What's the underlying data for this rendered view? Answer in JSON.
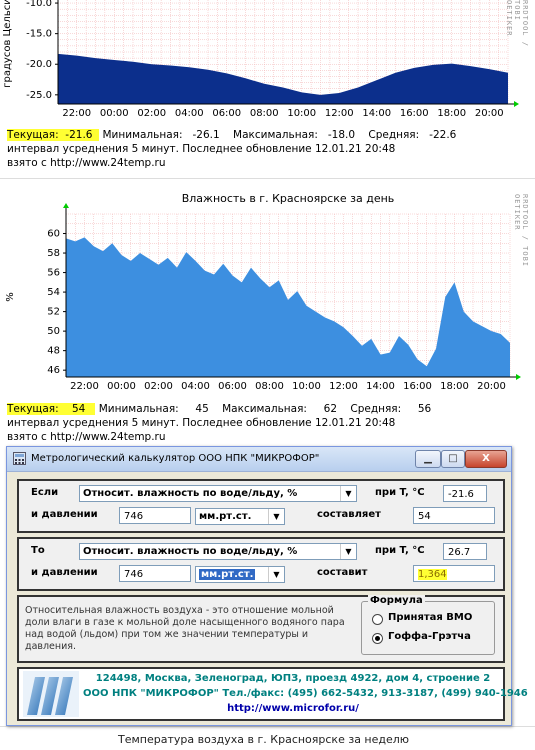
{
  "chart_top": {
    "chart_data": {
      "type": "area",
      "title": "",
      "ylabel": "градусов Цельсия",
      "ylim": [
        -26.5,
        -9.5
      ],
      "yticks": [
        "-10.0",
        "-15.0",
        "-20.0",
        "-25.0"
      ],
      "xticks": [
        "22:00",
        "00:00",
        "02:00",
        "04:00",
        "06:00",
        "08:00",
        "10:00",
        "12:00",
        "14:00",
        "16:00",
        "18:00",
        "20:00"
      ],
      "fill_color": "#0c2f8c",
      "x": [
        0,
        1,
        2,
        3,
        4,
        5,
        6,
        7,
        8,
        9,
        10,
        11,
        12,
        13,
        14,
        15,
        16,
        17,
        18,
        19,
        20,
        21,
        22,
        23,
        24
      ],
      "values": [
        -18.3,
        -18.6,
        -19.0,
        -19.3,
        -19.6,
        -20.0,
        -20.2,
        -20.5,
        -20.9,
        -21.5,
        -22.3,
        -23.2,
        -23.8,
        -24.6,
        -25.0,
        -24.7,
        -23.8,
        -22.6,
        -21.4,
        -20.6,
        -20.1,
        -19.9,
        -20.3,
        -20.8,
        -21.4
      ]
    },
    "stats": {
      "current_label": "Текущая:",
      "current_value": "-21.6",
      "min_label": "Минимальная:",
      "min_value": "-26.1",
      "max_label": "Максимальная:",
      "max_value": "-18.0",
      "avg_label": "Средняя:",
      "avg_value": "-22.6",
      "line2": "интервал усреднения 5 минут. Последнее обновление 12.01.21 20:48",
      "line3": "взято с http://www.24temp.ru"
    },
    "side_text": "RRDTOOL / TOBI OETIKER"
  },
  "chart_humidity": {
    "chart_data": {
      "type": "area",
      "title": "Влажность в г. Красноярске за день",
      "ylabel": "%",
      "ylim": [
        45.3,
        62
      ],
      "yticks": [
        "60",
        "58",
        "56",
        "54",
        "52",
        "50",
        "48",
        "46"
      ],
      "xticks": [
        "22:00",
        "00:00",
        "02:00",
        "04:00",
        "06:00",
        "08:00",
        "10:00",
        "12:00",
        "14:00",
        "16:00",
        "18:00",
        "20:00"
      ],
      "fill_color": "#3d8fe0",
      "x": [
        0,
        0.5,
        1,
        1.5,
        2,
        2.5,
        3,
        3.5,
        4,
        4.5,
        5,
        5.5,
        6,
        6.5,
        7,
        7.5,
        8,
        8.5,
        9,
        9.5,
        10,
        10.5,
        11,
        11.5,
        12,
        12.5,
        13,
        13.5,
        14,
        14.5,
        15,
        15.5,
        16,
        16.5,
        17,
        17.5,
        18,
        18.5,
        19,
        19.5,
        20,
        20.5,
        21,
        21.5,
        22,
        22.5,
        23,
        23.5,
        24
      ],
      "values": [
        59.5,
        59.2,
        59.6,
        58.7,
        58.2,
        59.0,
        57.8,
        57.2,
        58.0,
        57.4,
        56.8,
        57.5,
        56.5,
        58.1,
        57.2,
        56.2,
        55.8,
        56.9,
        55.7,
        55.0,
        56.5,
        55.4,
        54.5,
        55.2,
        53.2,
        54.1,
        52.6,
        52.0,
        51.4,
        51.0,
        50.4,
        49.5,
        48.5,
        49.2,
        47.6,
        47.8,
        49.5,
        48.6,
        47.1,
        46.4,
        48.2,
        53.5,
        55.0,
        52.0,
        51.0,
        50.5,
        50.0,
        49.7,
        48.8
      ]
    },
    "stats": {
      "current_label": "Текущая:",
      "current_value": "54",
      "min_label": "Минимальная:",
      "min_value": "45",
      "max_label": "Максимальная:",
      "max_value": "62",
      "avg_label": "Средняя:",
      "avg_value": "56",
      "line2": "интервал усреднения 5 минут. Последнее обновление 12.01.21 20:48",
      "line3": "взято с http://www.24temp.ru"
    },
    "side_text": "RRDTOOL / TOBI OETIKER"
  },
  "dialog": {
    "title": "Метрологический калькулятор ООО НПК \"МИКРОФОР\"",
    "minimize": "▁",
    "maximize": "□",
    "close": "X",
    "if_group": {
      "if_label": "Если",
      "param_value": "Относит. влажность по воде/льду, %",
      "temp_label": "при T, °C",
      "temp_value": "-21.6",
      "pressure_label": "и давлении",
      "pressure_value": "746",
      "unit_value": "мм.рт.ст.",
      "result_label": "составляет",
      "result_value": "54"
    },
    "then_group": {
      "then_label": "То",
      "param_value": "Относит. влажность по воде/льду, %",
      "temp_label": "при T, °C",
      "temp_value": "26.7",
      "pressure_label": "и давлении",
      "pressure_value": "746",
      "unit_value": "мм.рт.ст.",
      "result_label": "составит",
      "result_value": "1,364"
    },
    "description": "Относительная влажность воздуха - это отношение мольной доли влаги в газе к мольной доле насыщенного водяного пара над водой (льдом) при том же значении температуры и давления.",
    "formula": {
      "legend": "Формула",
      "option1": "Принятая ВМО",
      "option2": "Гоффа-Грэтча",
      "selected": "option2"
    },
    "footer": {
      "address": "124498, Москва, Зеленоград, ЮПЗ, проезд 4922, дом 4, строение 2",
      "contacts": "ООО НПК \"МИКРОФОР\" Тел./факс: (495) 662-5432, 913-3187, (499) 940-1946",
      "url": "http://www.microfor.ru/"
    }
  },
  "bottom_strip": {
    "title": "Температура воздуха в г. Красноярске за неделю"
  },
  "colors": {
    "highlight": "#ffff33",
    "grid_red": "#f2b3b3",
    "accent_green": "#00cc00",
    "footer_teal": "#008080",
    "footer_blue": "#0000aa"
  }
}
